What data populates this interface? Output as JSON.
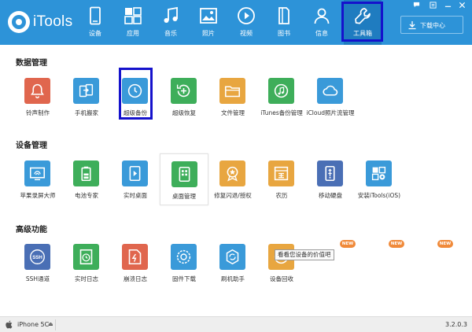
{
  "app": {
    "name": "iTools",
    "version": "3.2.0.3"
  },
  "nav": {
    "items": [
      {
        "key": "device",
        "label": "设备",
        "icon": "phone-icon"
      },
      {
        "key": "apps",
        "label": "应用",
        "icon": "apps-grid-icon"
      },
      {
        "key": "music",
        "label": "音乐",
        "icon": "music-note-icon"
      },
      {
        "key": "photos",
        "label": "照片",
        "icon": "photo-icon"
      },
      {
        "key": "video",
        "label": "视频",
        "icon": "play-circle-icon"
      },
      {
        "key": "books",
        "label": "图书",
        "icon": "book-icon"
      },
      {
        "key": "info",
        "label": "信息",
        "icon": "person-icon"
      },
      {
        "key": "toolbox",
        "label": "工具箱",
        "icon": "wrench-icon",
        "active": true
      }
    ],
    "download_center": "下载中心"
  },
  "sections": {
    "data": {
      "title": "数据管理",
      "tools": [
        {
          "label": "铃声制作",
          "icon": "bell-icon",
          "color": "#e0664e"
        },
        {
          "label": "手机搬家",
          "icon": "phone-transfer-icon",
          "color": "#3a9ad9"
        },
        {
          "label": "超级备份",
          "icon": "backup-clock-icon",
          "color": "#3a9ad9"
        },
        {
          "label": "超级恢复",
          "icon": "restore-plus-icon",
          "color": "#3eae5a"
        },
        {
          "label": "文件管理",
          "icon": "folder-icon",
          "color": "#e8a640"
        },
        {
          "label": "iTunes备份管理",
          "icon": "itunes-backup-icon",
          "color": "#3eae5a"
        },
        {
          "label": "iCloud照片流管理",
          "icon": "cloud-icon",
          "color": "#3a9ad9"
        }
      ]
    },
    "device": {
      "title": "设备管理",
      "tools": [
        {
          "label": "苹果录屏大师",
          "icon": "screen-cast-icon",
          "color": "#3a9ad9"
        },
        {
          "label": "电池专家",
          "icon": "battery-icon",
          "color": "#3eae5a"
        },
        {
          "label": "实时桌面",
          "icon": "realtime-desktop-icon",
          "color": "#3a9ad9"
        },
        {
          "label": "桌面管理",
          "icon": "desktop-grid-icon",
          "color": "#3eae5a"
        },
        {
          "label": "修复闪退/授权",
          "icon": "repair-badge-icon",
          "color": "#e8a640"
        },
        {
          "label": "农历",
          "icon": "lunar-calendar-icon",
          "color": "#e8a640"
        },
        {
          "label": "移动硬盘",
          "icon": "usb-drive-icon",
          "color": "#4a6fb5"
        },
        {
          "label": "安装iTools(iOS)",
          "icon": "install-itools-icon",
          "color": "#3a9ad9"
        }
      ]
    },
    "advanced": {
      "title": "高级功能",
      "tools": [
        {
          "label": "SSH通道",
          "icon": "ssh-icon",
          "color": "#4a6fb5"
        },
        {
          "label": "实时日志",
          "icon": "realtime-log-icon",
          "color": "#3eae5a"
        },
        {
          "label": "崩溃日志",
          "icon": "crash-log-icon",
          "color": "#e0664e"
        },
        {
          "label": "固件下载",
          "icon": "firmware-gear-icon",
          "color": "#3a9ad9"
        },
        {
          "label": "刷机助手",
          "icon": "flash-helper-icon",
          "color": "#3a9ad9"
        },
        {
          "label": "设备回收",
          "icon": "device-recycle-icon",
          "color": "#e8a640"
        }
      ],
      "new_badge": "NEW"
    }
  },
  "tooltip": "看看您设备的价值吧",
  "status": {
    "device": "iPhone 5C",
    "eject_symbol": "⏏"
  }
}
